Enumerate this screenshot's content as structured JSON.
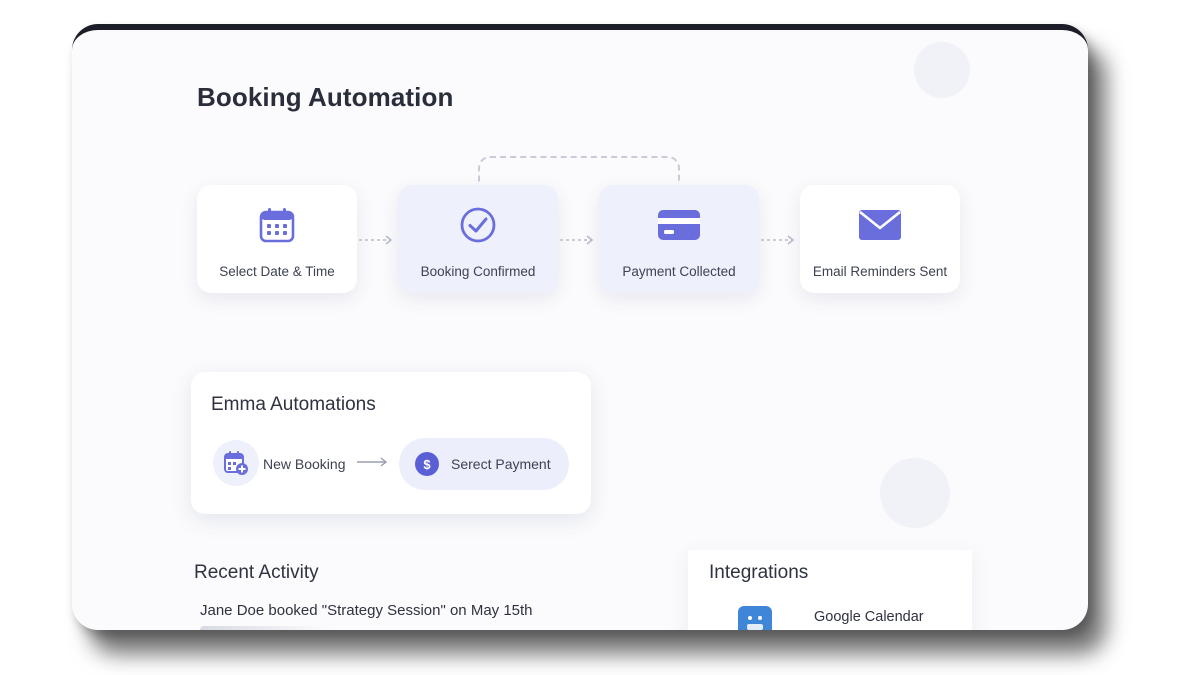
{
  "page": {
    "title": "Booking Automation"
  },
  "workflow": {
    "steps": [
      {
        "label": "Select Date & Time",
        "icon": "calendar-icon",
        "highlighted": false
      },
      {
        "label": "Booking Confirmed",
        "icon": "check-circle-icon",
        "highlighted": true
      },
      {
        "label": "Payment Collected",
        "icon": "credit-card-icon",
        "highlighted": true
      },
      {
        "label": "Email Reminders Sent",
        "icon": "envelope-icon",
        "highlighted": false
      }
    ]
  },
  "automations": {
    "title": "Emma Automations",
    "trigger_label": "New Booking",
    "trigger_icon": "calendar-add-icon",
    "action_label": "Serect Payment",
    "action_icon": "dollar-icon",
    "action_symbol": "$"
  },
  "recent_activity": {
    "title": "Recent Activity",
    "items": [
      "Jane Doe booked \"Strategy Session\" on May 15th"
    ]
  },
  "integrations": {
    "title": "Integrations",
    "items": [
      {
        "label": "Google Calendar",
        "icon": "google-calendar-icon"
      }
    ]
  },
  "colors": {
    "accent": "#5b5fd4",
    "card_highlight": "#eef0fc",
    "window_background": "#fbfbfd",
    "text_primary": "#2f3240"
  }
}
